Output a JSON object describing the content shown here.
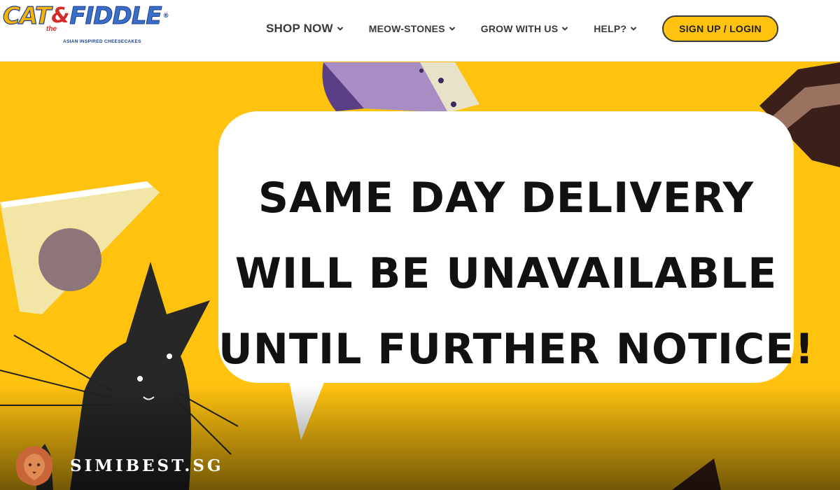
{
  "brand": {
    "logo_text_cat": "CAT",
    "logo_text_amp": "&",
    "logo_text_the": "the",
    "logo_text_fiddle": "FIDDLE",
    "logo_reg": "®",
    "tagline": "ASIAN INSPIRED CHEESECAKES"
  },
  "nav": {
    "items": [
      {
        "label": "SHOP NOW",
        "icon": "chevron-down-icon"
      },
      {
        "label": "MEOW-STONES",
        "icon": "chevron-down-icon"
      },
      {
        "label": "GROW WITH US",
        "icon": "chevron-down-icon"
      },
      {
        "label": "HELP?",
        "icon": "chevron-down-icon"
      }
    ],
    "signup_label": "SIGN UP / LOGIN"
  },
  "hero": {
    "lines": [
      "SAME DAY DELIVERY",
      "WILL BE UNAVAILABLE",
      "UNTIL FURTHER NOTICE!"
    ],
    "background_color": "#ffc20e",
    "bubble_color": "#ffffff"
  },
  "watermark": {
    "text": "SIMIBEST.SG",
    "icon": "lion-head-icon"
  },
  "colors": {
    "accent": "#ffc20e",
    "nav_text": "#3a3a3a"
  }
}
